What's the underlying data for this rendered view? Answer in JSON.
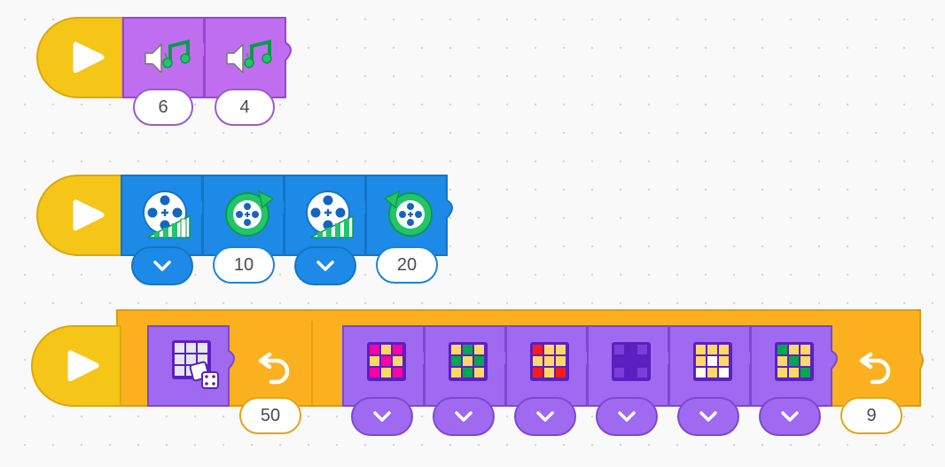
{
  "canvas": {
    "background": "#f9f9fa",
    "dot_color": "#d4d7dc"
  },
  "colors": {
    "event": "#f5c518",
    "sound": "#c06ef0",
    "motor": "#1d8ae8",
    "control": "#fbb11f",
    "light": "#9f69f0"
  },
  "stacks": [
    {
      "name": "sound-stack",
      "start_icon": "play-icon",
      "blocks": [
        {
          "icon": "speaker-music-icon",
          "input": "6"
        },
        {
          "icon": "speaker-music-icon",
          "input": "4"
        }
      ]
    },
    {
      "name": "motor-stack",
      "start_icon": "play-icon",
      "blocks": [
        {
          "icon": "motor-speed-icon",
          "dropdown_icon": "chevron-down-icon"
        },
        {
          "icon": "motor-clockwise-icon",
          "input": "10"
        },
        {
          "icon": "motor-speed-icon",
          "dropdown_icon": "chevron-down-icon"
        },
        {
          "icon": "motor-counterclockwise-icon",
          "input": "20"
        }
      ]
    },
    {
      "name": "light-stack",
      "start_icon": "play-icon",
      "outer_loop": {
        "icon": "repeat-icon",
        "count": "50"
      },
      "random_block": {
        "icon": "random-light-matrix-icon"
      },
      "inner_loop": {
        "icon": "repeat-icon",
        "count": "9"
      },
      "matrix_blocks": [
        {
          "icon": "light-matrix-icon",
          "pattern": [
            "#ff00a8",
            "#ffd866",
            "#ff00a8",
            "#ffd866",
            "#ff00a8",
            "#ffd866",
            "#ff00a8",
            "#ffd866",
            "#ff00a8"
          ]
        },
        {
          "icon": "light-matrix-icon",
          "pattern": [
            "#ffd866",
            "#00a84f",
            "#ffd866",
            "#00a84f",
            "#ffd866",
            "#00a84f",
            "#ffd866",
            "#00a84f",
            "#ffd866"
          ]
        },
        {
          "icon": "light-matrix-icon",
          "pattern": [
            "#ff1a1a",
            "#ffd866",
            "#ffd866",
            "#ffd866",
            "#ffd866",
            "#ffd866",
            "#ff1a1a",
            "#ffd866",
            "#ff1a1a"
          ]
        },
        {
          "icon": "light-matrix-icon",
          "pattern": [
            "#7b3fd8",
            "#5a20c0",
            "#7b3fd8",
            "#5a20c0",
            "#5a20c0",
            "#5a20c0",
            "#7b3fd8",
            "#5a20c0",
            "#7b3fd8"
          ]
        },
        {
          "icon": "light-matrix-icon",
          "pattern": [
            "#ffd866",
            "#ffd866",
            "#ffd866",
            "#ffd866",
            "#ffffff",
            "#ffd866",
            "#ffffff",
            "#ffd866",
            "#ffffff"
          ]
        },
        {
          "icon": "light-matrix-icon",
          "pattern": [
            "#00a84f",
            "#ffd866",
            "#ffd866",
            "#ffd866",
            "#00a84f",
            "#ffd866",
            "#ffd866",
            "#ffd866",
            "#00a84f"
          ]
        }
      ]
    }
  ]
}
